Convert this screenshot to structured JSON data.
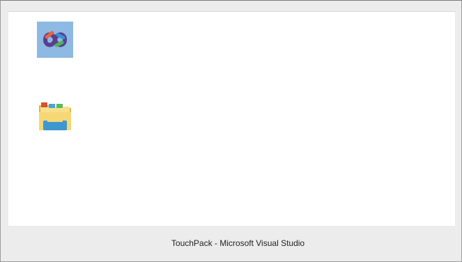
{
  "window": {
    "caption": "TouchPack - Microsoft Visual Studio"
  },
  "desktop": {
    "icons": [
      {
        "name": "visual-studio-icon"
      },
      {
        "name": "file-explorer-icon"
      }
    ]
  },
  "colors": {
    "background": "#ececec",
    "canvas": "#ffffff",
    "vs_tile": "#8db9e2",
    "folder_yellow": "#f2c94c",
    "folder_blue": "#4aa3d8"
  }
}
